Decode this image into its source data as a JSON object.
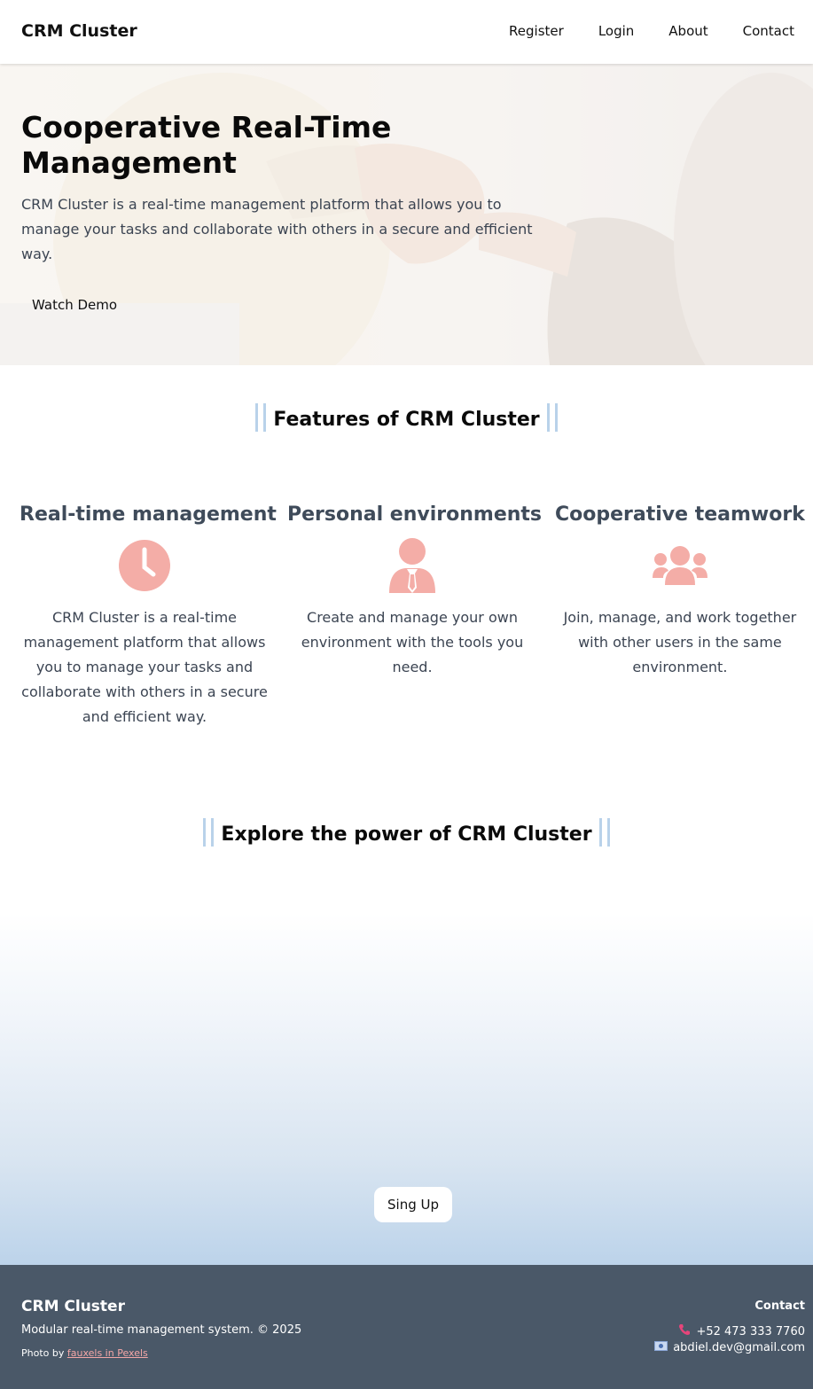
{
  "nav": {
    "brand": "CRM Cluster",
    "links": [
      "Register",
      "Login",
      "About",
      "Contact"
    ]
  },
  "hero": {
    "title": "Cooperative Real-Time Management",
    "text": "CRM Cluster is a real-time management platform that allows you to manage your tasks and collaborate with others in a secure and efficient way.",
    "button": "Watch Demo"
  },
  "features": {
    "title": "Features of CRM Cluster",
    "items": [
      {
        "title": "Real-time management",
        "icon": "clock-icon",
        "text": "CRM Cluster is a real-time management platform that allows you to manage your tasks and collaborate with others in a secure and efficient way."
      },
      {
        "title": "Personal environments",
        "icon": "user-tie-icon",
        "text": "Create and manage your own environment with the tools you need."
      },
      {
        "title": "Cooperative teamwork",
        "icon": "users-icon",
        "text": "Join, manage, and work together with other users in the same environment."
      }
    ]
  },
  "explore": {
    "title": "Explore the power of CRM Cluster",
    "button": "Sing Up"
  },
  "footer": {
    "brand": "CRM Cluster",
    "description": "Modular real-time management system. © 2025",
    "photo_prefix": "Photo by ",
    "photo_link": "fauxels in Pexels",
    "contact_title": "Contact",
    "phone": "+52 473 333 7760",
    "email": "abdiel.dev@gmail.com"
  },
  "colors": {
    "accent_icon": "#f4ada7",
    "title_bars": "#b9d2ea",
    "footer_bg": "#4a5868",
    "link": "#f4a7a7"
  }
}
